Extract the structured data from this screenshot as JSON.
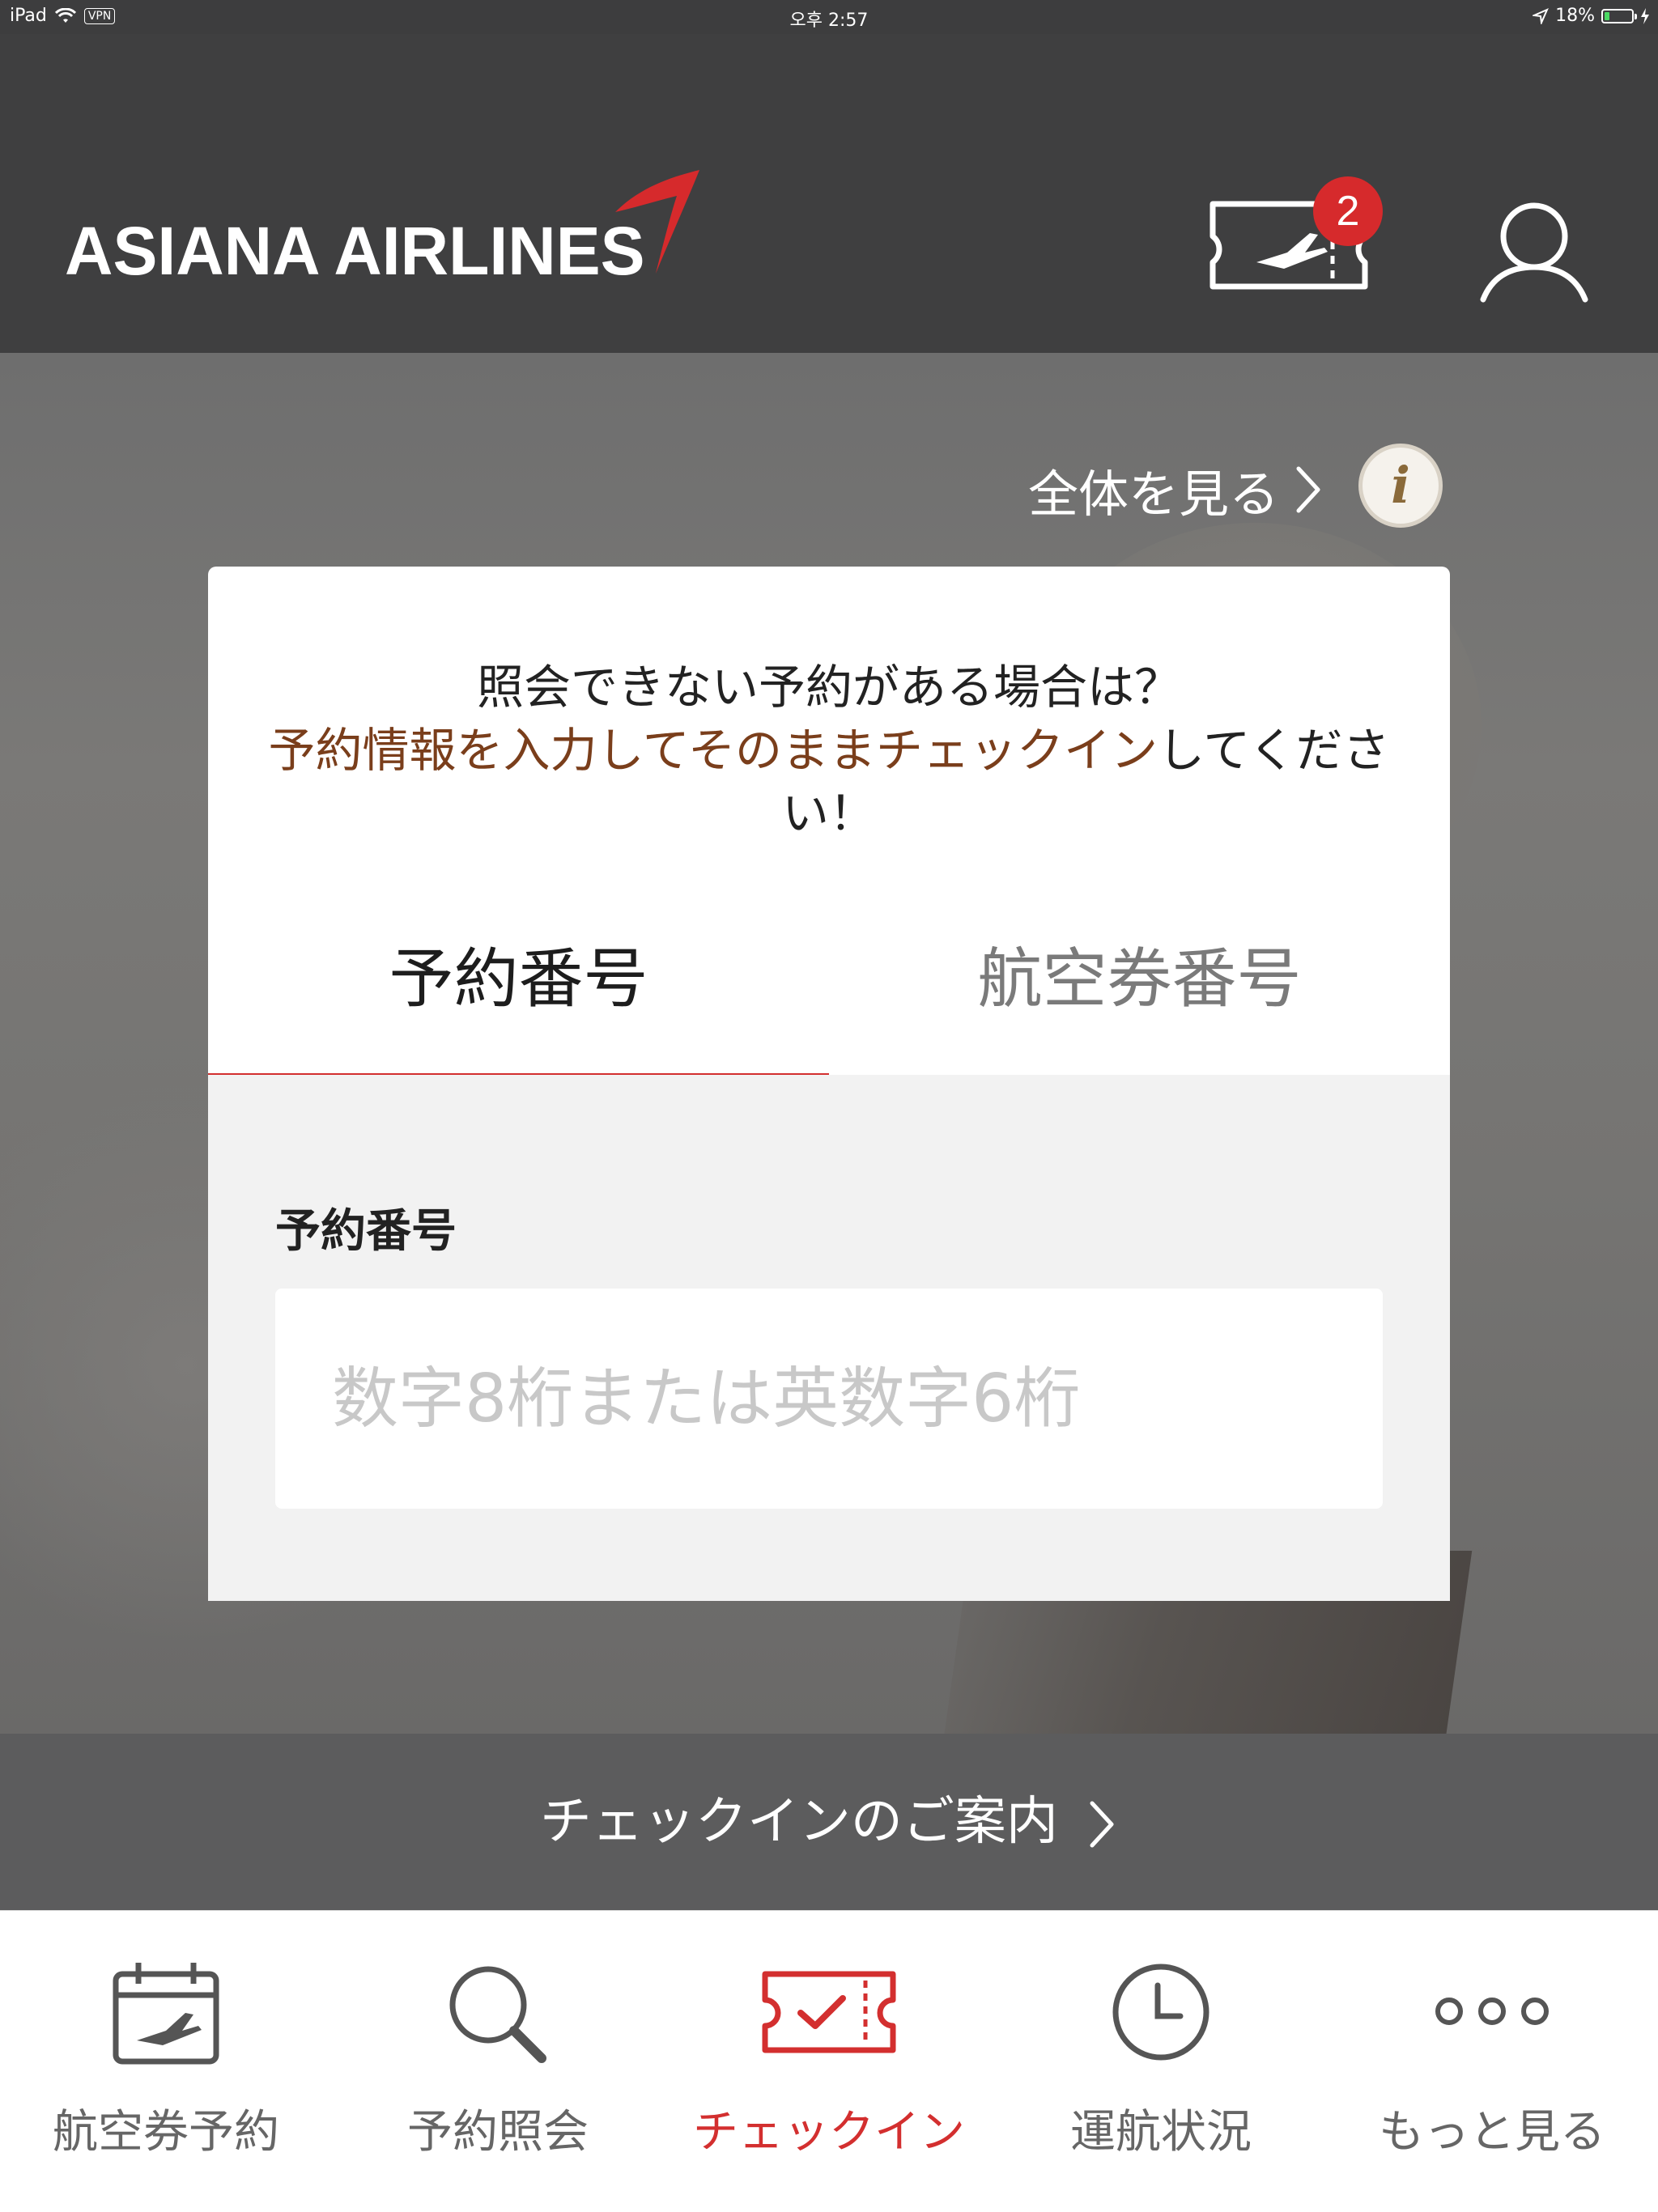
{
  "status_bar": {
    "device": "iPad",
    "vpn": "VPN",
    "time": "오후 2:57",
    "battery": "18%",
    "battery_level": 0.18
  },
  "header": {
    "logo_text": "ASIANA AIRLINES",
    "ticket_badge_count": "2",
    "icons": [
      "boarding-pass-icon",
      "user-icon"
    ]
  },
  "hero": {
    "view_all_label": "全体を見る",
    "info_label": "i"
  },
  "card": {
    "notice_line1": "照会できない予約がある場合は？",
    "notice_highlight": "予約情報を入力してそのままチェックイン",
    "notice_tail": "してください！",
    "tabs": [
      {
        "label": "予約番号",
        "active": true
      },
      {
        "label": "航空券番号",
        "active": false
      }
    ],
    "field": {
      "label": "予約番号",
      "value": "",
      "placeholder": "数字8桁または英数字6桁"
    }
  },
  "guide": {
    "label": "チェックインのご案内"
  },
  "tab_bar": {
    "items": [
      {
        "label": "航空券予約",
        "icon": "calendar-plane-icon",
        "active": false
      },
      {
        "label": "予約照会",
        "icon": "search-icon",
        "active": false
      },
      {
        "label": "チェックイン",
        "icon": "checkin-ticket-icon",
        "active": true
      },
      {
        "label": "運航状況",
        "icon": "clock-icon",
        "active": false
      },
      {
        "label": "もっと見る",
        "icon": "more-dots-icon",
        "active": false
      }
    ]
  },
  "colors": {
    "header_bg": "#3f3f40",
    "accent_red": "#d32f2f",
    "highlight_brown": "#7a3e1b",
    "guide_bg": "#5c5c5d"
  }
}
